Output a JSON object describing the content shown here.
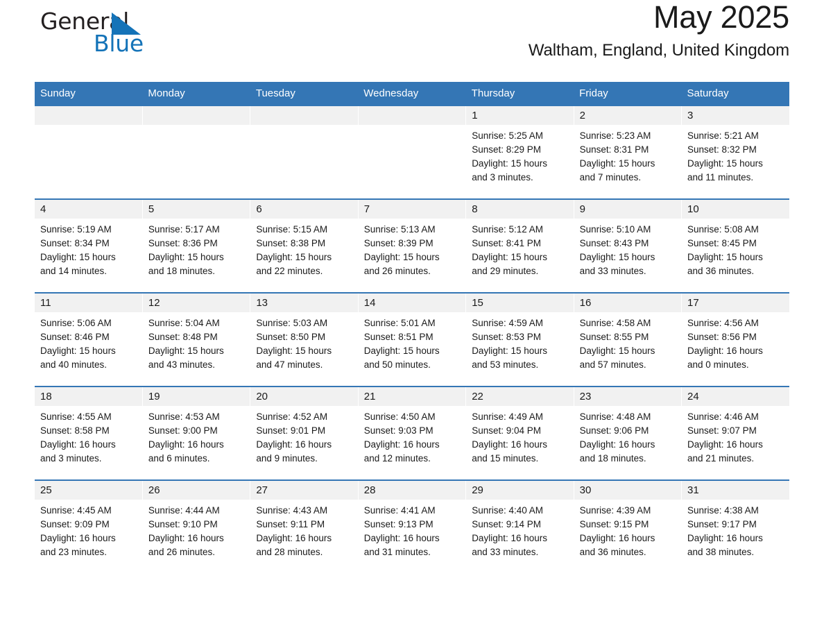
{
  "brand": {
    "name_part1": "General",
    "name_part2": "Blue",
    "accent_color": "#1473b8"
  },
  "header": {
    "title": "May 2025",
    "location": "Waltham, England, United Kingdom"
  },
  "theme": {
    "header_blue": "#3476b5",
    "daynum_band": "#f1f1f1",
    "text": "#1a1a1a"
  },
  "weekday_headers": [
    "Sunday",
    "Monday",
    "Tuesday",
    "Wednesday",
    "Thursday",
    "Friday",
    "Saturday"
  ],
  "labels": {
    "sunrise_prefix": "Sunrise:",
    "sunset_prefix": "Sunset:",
    "daylight_prefix": "Daylight:"
  },
  "weeks": [
    [
      {
        "empty": true,
        "day": ""
      },
      {
        "empty": true,
        "day": ""
      },
      {
        "empty": true,
        "day": ""
      },
      {
        "empty": true,
        "day": ""
      },
      {
        "day": "1",
        "sunrise": "Sunrise: 5:25 AM",
        "sunset": "Sunset: 8:29 PM",
        "daylight_l1": "Daylight: 15 hours",
        "daylight_l2": "and 3 minutes."
      },
      {
        "day": "2",
        "sunrise": "Sunrise: 5:23 AM",
        "sunset": "Sunset: 8:31 PM",
        "daylight_l1": "Daylight: 15 hours",
        "daylight_l2": "and 7 minutes."
      },
      {
        "day": "3",
        "sunrise": "Sunrise: 5:21 AM",
        "sunset": "Sunset: 8:32 PM",
        "daylight_l1": "Daylight: 15 hours",
        "daylight_l2": "and 11 minutes."
      }
    ],
    [
      {
        "day": "4",
        "sunrise": "Sunrise: 5:19 AM",
        "sunset": "Sunset: 8:34 PM",
        "daylight_l1": "Daylight: 15 hours",
        "daylight_l2": "and 14 minutes."
      },
      {
        "day": "5",
        "sunrise": "Sunrise: 5:17 AM",
        "sunset": "Sunset: 8:36 PM",
        "daylight_l1": "Daylight: 15 hours",
        "daylight_l2": "and 18 minutes."
      },
      {
        "day": "6",
        "sunrise": "Sunrise: 5:15 AM",
        "sunset": "Sunset: 8:38 PM",
        "daylight_l1": "Daylight: 15 hours",
        "daylight_l2": "and 22 minutes."
      },
      {
        "day": "7",
        "sunrise": "Sunrise: 5:13 AM",
        "sunset": "Sunset: 8:39 PM",
        "daylight_l1": "Daylight: 15 hours",
        "daylight_l2": "and 26 minutes."
      },
      {
        "day": "8",
        "sunrise": "Sunrise: 5:12 AM",
        "sunset": "Sunset: 8:41 PM",
        "daylight_l1": "Daylight: 15 hours",
        "daylight_l2": "and 29 minutes."
      },
      {
        "day": "9",
        "sunrise": "Sunrise: 5:10 AM",
        "sunset": "Sunset: 8:43 PM",
        "daylight_l1": "Daylight: 15 hours",
        "daylight_l2": "and 33 minutes."
      },
      {
        "day": "10",
        "sunrise": "Sunrise: 5:08 AM",
        "sunset": "Sunset: 8:45 PM",
        "daylight_l1": "Daylight: 15 hours",
        "daylight_l2": "and 36 minutes."
      }
    ],
    [
      {
        "day": "11",
        "sunrise": "Sunrise: 5:06 AM",
        "sunset": "Sunset: 8:46 PM",
        "daylight_l1": "Daylight: 15 hours",
        "daylight_l2": "and 40 minutes."
      },
      {
        "day": "12",
        "sunrise": "Sunrise: 5:04 AM",
        "sunset": "Sunset: 8:48 PM",
        "daylight_l1": "Daylight: 15 hours",
        "daylight_l2": "and 43 minutes."
      },
      {
        "day": "13",
        "sunrise": "Sunrise: 5:03 AM",
        "sunset": "Sunset: 8:50 PM",
        "daylight_l1": "Daylight: 15 hours",
        "daylight_l2": "and 47 minutes."
      },
      {
        "day": "14",
        "sunrise": "Sunrise: 5:01 AM",
        "sunset": "Sunset: 8:51 PM",
        "daylight_l1": "Daylight: 15 hours",
        "daylight_l2": "and 50 minutes."
      },
      {
        "day": "15",
        "sunrise": "Sunrise: 4:59 AM",
        "sunset": "Sunset: 8:53 PM",
        "daylight_l1": "Daylight: 15 hours",
        "daylight_l2": "and 53 minutes."
      },
      {
        "day": "16",
        "sunrise": "Sunrise: 4:58 AM",
        "sunset": "Sunset: 8:55 PM",
        "daylight_l1": "Daylight: 15 hours",
        "daylight_l2": "and 57 minutes."
      },
      {
        "day": "17",
        "sunrise": "Sunrise: 4:56 AM",
        "sunset": "Sunset: 8:56 PM",
        "daylight_l1": "Daylight: 16 hours",
        "daylight_l2": "and 0 minutes."
      }
    ],
    [
      {
        "day": "18",
        "sunrise": "Sunrise: 4:55 AM",
        "sunset": "Sunset: 8:58 PM",
        "daylight_l1": "Daylight: 16 hours",
        "daylight_l2": "and 3 minutes."
      },
      {
        "day": "19",
        "sunrise": "Sunrise: 4:53 AM",
        "sunset": "Sunset: 9:00 PM",
        "daylight_l1": "Daylight: 16 hours",
        "daylight_l2": "and 6 minutes."
      },
      {
        "day": "20",
        "sunrise": "Sunrise: 4:52 AM",
        "sunset": "Sunset: 9:01 PM",
        "daylight_l1": "Daylight: 16 hours",
        "daylight_l2": "and 9 minutes."
      },
      {
        "day": "21",
        "sunrise": "Sunrise: 4:50 AM",
        "sunset": "Sunset: 9:03 PM",
        "daylight_l1": "Daylight: 16 hours",
        "daylight_l2": "and 12 minutes."
      },
      {
        "day": "22",
        "sunrise": "Sunrise: 4:49 AM",
        "sunset": "Sunset: 9:04 PM",
        "daylight_l1": "Daylight: 16 hours",
        "daylight_l2": "and 15 minutes."
      },
      {
        "day": "23",
        "sunrise": "Sunrise: 4:48 AM",
        "sunset": "Sunset: 9:06 PM",
        "daylight_l1": "Daylight: 16 hours",
        "daylight_l2": "and 18 minutes."
      },
      {
        "day": "24",
        "sunrise": "Sunrise: 4:46 AM",
        "sunset": "Sunset: 9:07 PM",
        "daylight_l1": "Daylight: 16 hours",
        "daylight_l2": "and 21 minutes."
      }
    ],
    [
      {
        "day": "25",
        "sunrise": "Sunrise: 4:45 AM",
        "sunset": "Sunset: 9:09 PM",
        "daylight_l1": "Daylight: 16 hours",
        "daylight_l2": "and 23 minutes."
      },
      {
        "day": "26",
        "sunrise": "Sunrise: 4:44 AM",
        "sunset": "Sunset: 9:10 PM",
        "daylight_l1": "Daylight: 16 hours",
        "daylight_l2": "and 26 minutes."
      },
      {
        "day": "27",
        "sunrise": "Sunrise: 4:43 AM",
        "sunset": "Sunset: 9:11 PM",
        "daylight_l1": "Daylight: 16 hours",
        "daylight_l2": "and 28 minutes."
      },
      {
        "day": "28",
        "sunrise": "Sunrise: 4:41 AM",
        "sunset": "Sunset: 9:13 PM",
        "daylight_l1": "Daylight: 16 hours",
        "daylight_l2": "and 31 minutes."
      },
      {
        "day": "29",
        "sunrise": "Sunrise: 4:40 AM",
        "sunset": "Sunset: 9:14 PM",
        "daylight_l1": "Daylight: 16 hours",
        "daylight_l2": "and 33 minutes."
      },
      {
        "day": "30",
        "sunrise": "Sunrise: 4:39 AM",
        "sunset": "Sunset: 9:15 PM",
        "daylight_l1": "Daylight: 16 hours",
        "daylight_l2": "and 36 minutes."
      },
      {
        "day": "31",
        "sunrise": "Sunrise: 4:38 AM",
        "sunset": "Sunset: 9:17 PM",
        "daylight_l1": "Daylight: 16 hours",
        "daylight_l2": "and 38 minutes."
      }
    ]
  ]
}
